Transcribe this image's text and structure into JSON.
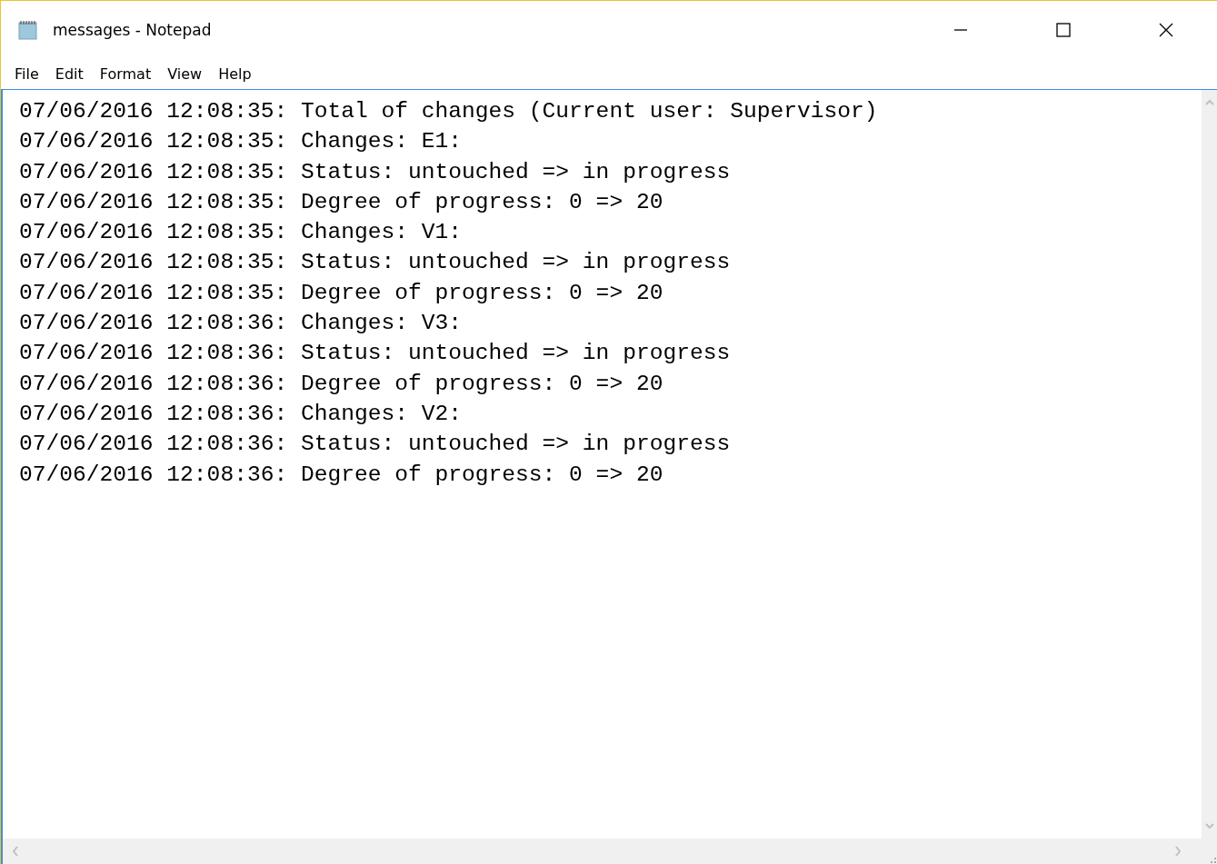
{
  "window": {
    "title": "messages - Notepad"
  },
  "menu": [
    "File",
    "Edit",
    "Format",
    "View",
    "Help"
  ],
  "lines": [
    "07/06/2016 12:08:35: Total of changes (Current user: Supervisor)",
    "07/06/2016 12:08:35: Changes: E1:",
    "07/06/2016 12:08:35: Status: untouched => in progress",
    "07/06/2016 12:08:35: Degree of progress: 0 => 20",
    "07/06/2016 12:08:35: Changes: V1:",
    "07/06/2016 12:08:35: Status: untouched => in progress",
    "07/06/2016 12:08:35: Degree of progress: 0 => 20",
    "07/06/2016 12:08:36: Changes: V3:",
    "07/06/2016 12:08:36: Status: untouched => in progress",
    "07/06/2016 12:08:36: Degree of progress: 0 => 20",
    "07/06/2016 12:08:36: Changes: V2:",
    "07/06/2016 12:08:36: Status: untouched => in progress",
    "07/06/2016 12:08:36: Degree of progress: 0 => 20"
  ]
}
